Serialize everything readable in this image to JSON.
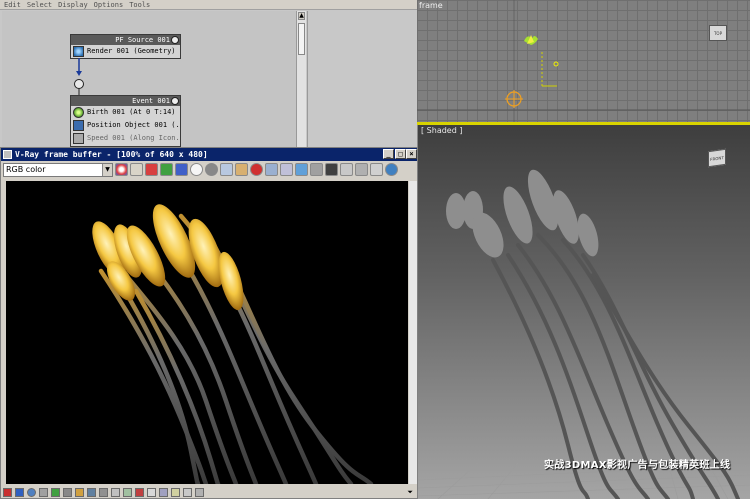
{
  "particle_view": {
    "menu": [
      "Edit",
      "Select",
      "Display",
      "Options",
      "Tools"
    ],
    "source_node": {
      "title": "PF Source 001",
      "rows": [
        "Render 001 (Geometry)"
      ]
    },
    "event_node": {
      "title": "Event 001",
      "rows": [
        "Birth 001 (At 0 T:14)",
        "Position Object 001 (...",
        "Speed 001 (Along Icon..."
      ]
    }
  },
  "viewports": {
    "top_label": "frame",
    "persp_label": "[ Shaded ]",
    "watermark": "实战3DMAX影视广告与包装精英班上线",
    "viewcube_top": "TOP",
    "viewcube_persp": "FRONT"
  },
  "vfb": {
    "title": "V-Ray frame buffer - [100% of 640 x 480]",
    "channel": "RGB color",
    "window_buttons": [
      "_",
      "□",
      "×"
    ]
  },
  "colors": {
    "vfb_title_bg": "#0a246a",
    "selection_yellow": "#d9d400",
    "tentacle_glow": "#f5c842"
  }
}
